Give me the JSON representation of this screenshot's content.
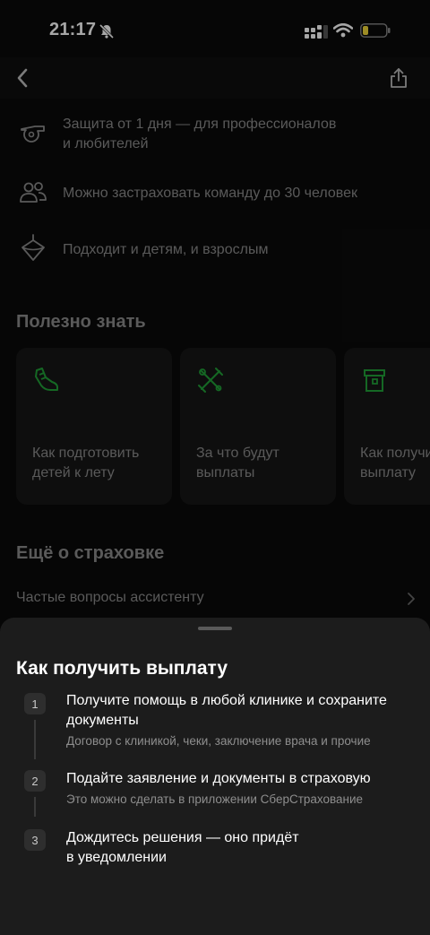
{
  "status_bar": {
    "time": "21:17",
    "icons": [
      "bell-slash-icon",
      "signal-icon",
      "wifi-icon",
      "battery-low-icon"
    ]
  },
  "top_bar": {
    "icons": [
      "back-arrow-icon",
      "share-icon"
    ]
  },
  "features": [
    {
      "icon": "whistle-icon",
      "text": "Защита от 1 дня — для профессионалов\nи любителей"
    },
    {
      "icon": "people-icon",
      "text": "Можно застраховать команду до 30 человек"
    },
    {
      "icon": "spinning-top-icon",
      "text": "Подходит и детям, и взрослым"
    }
  ],
  "useful": {
    "title": "Полезно знать",
    "cards": [
      {
        "icon": "sneaker-icon",
        "text": "Как подготовить\nдетей к лету"
      },
      {
        "icon": "crossed-tools-icon",
        "text": "За что будут\nвыплаты"
      },
      {
        "icon": "document-icon",
        "text": "Как получить\nвыплату"
      }
    ]
  },
  "more": {
    "title": "Ещё о страховке",
    "faq_label": "Частые вопросы ассистенту"
  },
  "sheet": {
    "title": "Как получить выплату",
    "steps": [
      {
        "num": "1",
        "title": "Получите помощь в любой клинике и сохраните\nдокументы",
        "desc": "Договор с клиникой, чеки, заключение врача и прочие"
      },
      {
        "num": "2",
        "title": "Подайте заявление и документы в страховую",
        "desc": "Это можно сделать в приложении СберСтрахование"
      },
      {
        "num": "3",
        "title": "Дождитесь решения — оно придёт\nв уведомлении",
        "desc": ""
      }
    ]
  },
  "colors": {
    "accent_green": "#21a038",
    "background": "#0a0a0a",
    "sheet": "#1c1c1c",
    "battery": "#f2d83a"
  }
}
